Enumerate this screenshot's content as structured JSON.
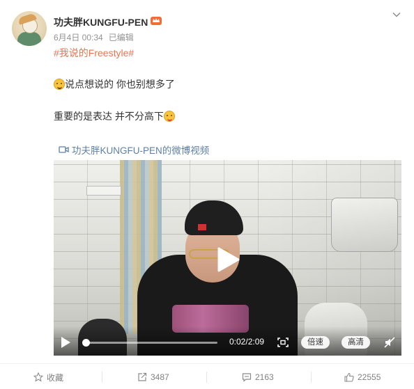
{
  "post": {
    "author": "功夫胖KUNGFU-PEN",
    "date": "6月4日 00:34",
    "edited": "已编辑",
    "topic": "#我说的Freestyle#",
    "line1": "说点想说的 你也别想多了",
    "line2": "重要的是表达 并不分高下",
    "video_link": "功夫胖KUNGFU-PEN的微博视频"
  },
  "video": {
    "time": "0:02/2:09",
    "progress": 0.016,
    "speed_label": "倍速",
    "quality_label": "高清"
  },
  "actions": {
    "favorite": "收藏",
    "share": "3487",
    "comment": "2163",
    "like": "22555"
  },
  "colors": {
    "topic": "#eb7350",
    "link": "#5d7fa7",
    "meta": "#939393"
  },
  "icons": [
    "avatar",
    "crown-icon",
    "chevron-down-icon",
    "emoji-upside-down-icon",
    "emoji-tongue-icon",
    "video-camera-icon",
    "play-icon",
    "fullscreen-icon",
    "mute-icon",
    "star-icon",
    "share-icon",
    "comment-icon",
    "like-icon"
  ]
}
